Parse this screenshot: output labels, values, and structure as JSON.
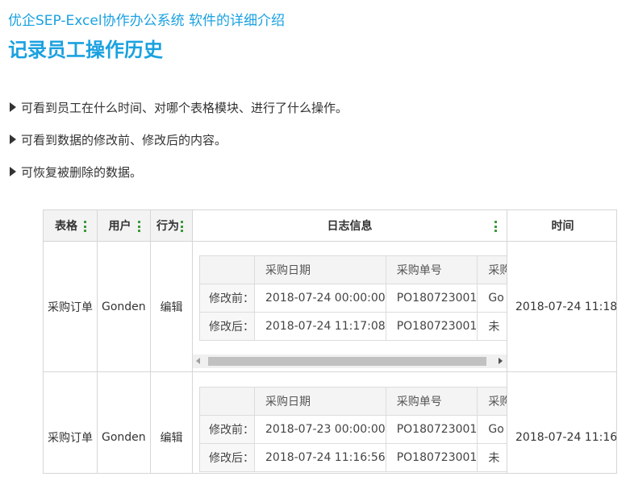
{
  "header": {
    "subtitle": "优企SEP-Excel协作办公系统 软件的详细介绍",
    "title": "记录员工操作历史"
  },
  "bullets": [
    "可看到员工在什么时间、对哪个表格模块、进行了什么操作。",
    "可看到数据的修改前、修改后的内容。",
    "可恢复被删除的数据。"
  ],
  "grid": {
    "columns": [
      "表格",
      "用户",
      "行为",
      "日志信息",
      "时间"
    ],
    "rows": [
      {
        "table": "采购订单",
        "user": "Gonden",
        "action": "编辑",
        "time": "2018-07-24 11:18",
        "log": {
          "headers": [
            "",
            "采购日期",
            "采购单号",
            "采购"
          ],
          "rows": [
            [
              "修改前：",
              "2018-07-24 00:00:00",
              "PO180723001",
              "Go"
            ],
            [
              "修改后：",
              "2018-07-24 11:17:08",
              "PO180723001",
              "未"
            ]
          ]
        }
      },
      {
        "table": "采购订单",
        "user": "Gonden",
        "action": "编辑",
        "time": "2018-07-24 11:16",
        "log": {
          "headers": [
            "",
            "采购日期",
            "采购单号",
            "采购"
          ],
          "rows": [
            [
              "修改前：",
              "2018-07-23 00:00:00",
              "PO180723001",
              "Go"
            ],
            [
              "修改后：",
              "2018-07-24 11:16:56",
              "PO180723001",
              "未"
            ]
          ]
        }
      }
    ]
  },
  "colors": {
    "accent": "#1aa1e0",
    "kebab": "#3a9b3a"
  }
}
